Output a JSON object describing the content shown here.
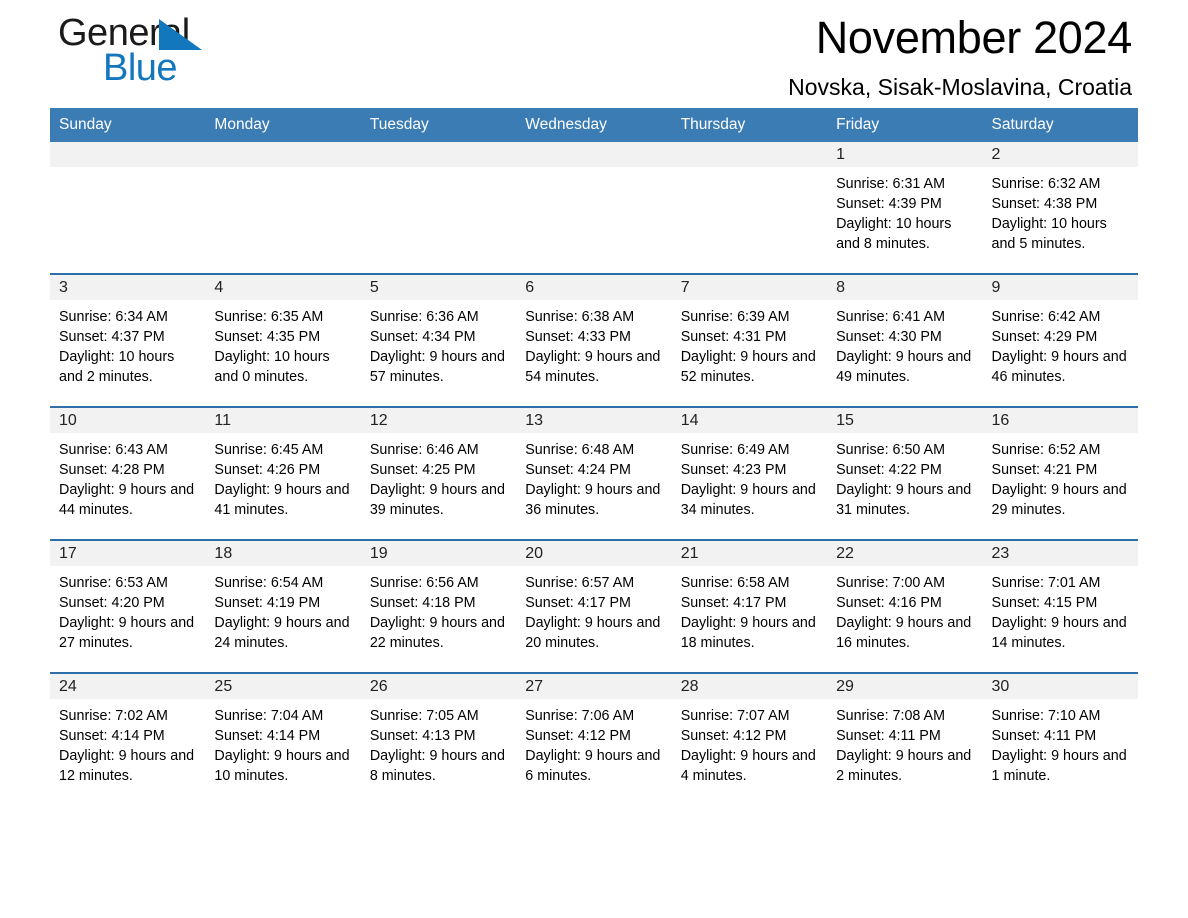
{
  "brand": {
    "name_part1": "General",
    "name_part2": "Blue",
    "triangle_color": "#1277bc"
  },
  "header": {
    "title": "November 2024",
    "location": "Novska, Sisak-Moslavina, Croatia"
  },
  "theme": {
    "header_blue": "#3b7cb5",
    "row_rule_blue": "#2f6fa8",
    "daynum_band": "#f2f2f2"
  },
  "calendar": {
    "weekdays": [
      "Sunday",
      "Monday",
      "Tuesday",
      "Wednesday",
      "Thursday",
      "Friday",
      "Saturday"
    ],
    "labels": {
      "sunrise": "Sunrise:",
      "sunset": "Sunset:",
      "daylight": "Daylight:"
    },
    "weeks": [
      [
        {
          "day": "",
          "empty": true
        },
        {
          "day": "",
          "empty": true
        },
        {
          "day": "",
          "empty": true
        },
        {
          "day": "",
          "empty": true
        },
        {
          "day": "",
          "empty": true
        },
        {
          "day": "1",
          "sunrise": "Sunrise: 6:31 AM",
          "sunset": "Sunset: 4:39 PM",
          "daylight": "Daylight: 10 hours and 8 minutes."
        },
        {
          "day": "2",
          "sunrise": "Sunrise: 6:32 AM",
          "sunset": "Sunset: 4:38 PM",
          "daylight": "Daylight: 10 hours and 5 minutes."
        }
      ],
      [
        {
          "day": "3",
          "sunrise": "Sunrise: 6:34 AM",
          "sunset": "Sunset: 4:37 PM",
          "daylight": "Daylight: 10 hours and 2 minutes."
        },
        {
          "day": "4",
          "sunrise": "Sunrise: 6:35 AM",
          "sunset": "Sunset: 4:35 PM",
          "daylight": "Daylight: 10 hours and 0 minutes."
        },
        {
          "day": "5",
          "sunrise": "Sunrise: 6:36 AM",
          "sunset": "Sunset: 4:34 PM",
          "daylight": "Daylight: 9 hours and 57 minutes."
        },
        {
          "day": "6",
          "sunrise": "Sunrise: 6:38 AM",
          "sunset": "Sunset: 4:33 PM",
          "daylight": "Daylight: 9 hours and 54 minutes."
        },
        {
          "day": "7",
          "sunrise": "Sunrise: 6:39 AM",
          "sunset": "Sunset: 4:31 PM",
          "daylight": "Daylight: 9 hours and 52 minutes."
        },
        {
          "day": "8",
          "sunrise": "Sunrise: 6:41 AM",
          "sunset": "Sunset: 4:30 PM",
          "daylight": "Daylight: 9 hours and 49 minutes."
        },
        {
          "day": "9",
          "sunrise": "Sunrise: 6:42 AM",
          "sunset": "Sunset: 4:29 PM",
          "daylight": "Daylight: 9 hours and 46 minutes."
        }
      ],
      [
        {
          "day": "10",
          "sunrise": "Sunrise: 6:43 AM",
          "sunset": "Sunset: 4:28 PM",
          "daylight": "Daylight: 9 hours and 44 minutes."
        },
        {
          "day": "11",
          "sunrise": "Sunrise: 6:45 AM",
          "sunset": "Sunset: 4:26 PM",
          "daylight": "Daylight: 9 hours and 41 minutes."
        },
        {
          "day": "12",
          "sunrise": "Sunrise: 6:46 AM",
          "sunset": "Sunset: 4:25 PM",
          "daylight": "Daylight: 9 hours and 39 minutes."
        },
        {
          "day": "13",
          "sunrise": "Sunrise: 6:48 AM",
          "sunset": "Sunset: 4:24 PM",
          "daylight": "Daylight: 9 hours and 36 minutes."
        },
        {
          "day": "14",
          "sunrise": "Sunrise: 6:49 AM",
          "sunset": "Sunset: 4:23 PM",
          "daylight": "Daylight: 9 hours and 34 minutes."
        },
        {
          "day": "15",
          "sunrise": "Sunrise: 6:50 AM",
          "sunset": "Sunset: 4:22 PM",
          "daylight": "Daylight: 9 hours and 31 minutes."
        },
        {
          "day": "16",
          "sunrise": "Sunrise: 6:52 AM",
          "sunset": "Sunset: 4:21 PM",
          "daylight": "Daylight: 9 hours and 29 minutes."
        }
      ],
      [
        {
          "day": "17",
          "sunrise": "Sunrise: 6:53 AM",
          "sunset": "Sunset: 4:20 PM",
          "daylight": "Daylight: 9 hours and 27 minutes."
        },
        {
          "day": "18",
          "sunrise": "Sunrise: 6:54 AM",
          "sunset": "Sunset: 4:19 PM",
          "daylight": "Daylight: 9 hours and 24 minutes."
        },
        {
          "day": "19",
          "sunrise": "Sunrise: 6:56 AM",
          "sunset": "Sunset: 4:18 PM",
          "daylight": "Daylight: 9 hours and 22 minutes."
        },
        {
          "day": "20",
          "sunrise": "Sunrise: 6:57 AM",
          "sunset": "Sunset: 4:17 PM",
          "daylight": "Daylight: 9 hours and 20 minutes."
        },
        {
          "day": "21",
          "sunrise": "Sunrise: 6:58 AM",
          "sunset": "Sunset: 4:17 PM",
          "daylight": "Daylight: 9 hours and 18 minutes."
        },
        {
          "day": "22",
          "sunrise": "Sunrise: 7:00 AM",
          "sunset": "Sunset: 4:16 PM",
          "daylight": "Daylight: 9 hours and 16 minutes."
        },
        {
          "day": "23",
          "sunrise": "Sunrise: 7:01 AM",
          "sunset": "Sunset: 4:15 PM",
          "daylight": "Daylight: 9 hours and 14 minutes."
        }
      ],
      [
        {
          "day": "24",
          "sunrise": "Sunrise: 7:02 AM",
          "sunset": "Sunset: 4:14 PM",
          "daylight": "Daylight: 9 hours and 12 minutes."
        },
        {
          "day": "25",
          "sunrise": "Sunrise: 7:04 AM",
          "sunset": "Sunset: 4:14 PM",
          "daylight": "Daylight: 9 hours and 10 minutes."
        },
        {
          "day": "26",
          "sunrise": "Sunrise: 7:05 AM",
          "sunset": "Sunset: 4:13 PM",
          "daylight": "Daylight: 9 hours and 8 minutes."
        },
        {
          "day": "27",
          "sunrise": "Sunrise: 7:06 AM",
          "sunset": "Sunset: 4:12 PM",
          "daylight": "Daylight: 9 hours and 6 minutes."
        },
        {
          "day": "28",
          "sunrise": "Sunrise: 7:07 AM",
          "sunset": "Sunset: 4:12 PM",
          "daylight": "Daylight: 9 hours and 4 minutes."
        },
        {
          "day": "29",
          "sunrise": "Sunrise: 7:08 AM",
          "sunset": "Sunset: 4:11 PM",
          "daylight": "Daylight: 9 hours and 2 minutes."
        },
        {
          "day": "30",
          "sunrise": "Sunrise: 7:10 AM",
          "sunset": "Sunset: 4:11 PM",
          "daylight": "Daylight: 9 hours and 1 minute."
        }
      ]
    ]
  }
}
